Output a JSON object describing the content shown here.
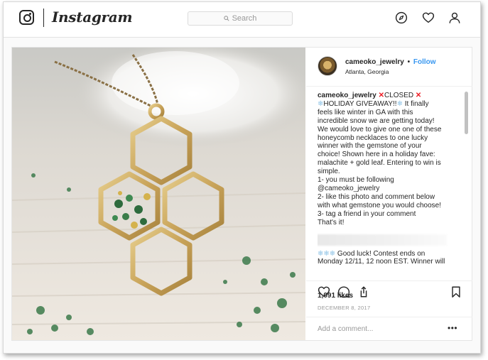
{
  "nav": {
    "brand": "Instagram",
    "search_placeholder": "Search",
    "icons": [
      "instagram-glyph-icon",
      "compass-icon",
      "heart-icon",
      "profile-icon"
    ]
  },
  "post": {
    "username": "cameoko_jewelry",
    "separator": "•",
    "follow_label": "Follow",
    "location": "Atlanta, Georgia",
    "caption_lines": [
      "It finally",
      "feels like winter in GA with this",
      "incredible snow we are getting today!",
      "We would love to give one one of these",
      "honeycomb necklaces to one lucky",
      "winner with the gemstone of your",
      "choice! Shown here in a holiday fave:",
      "malachite + gold leaf. Entering to win is",
      "simple.",
      "1- you must be following",
      "@cameoko_jewelry",
      "2- like this photo and comment below",
      "with what gemstone you would choose!",
      "3- tag a friend in your comment",
      "That's it!"
    ],
    "caption_head_closed": "CLOSED",
    "caption_head_giveaway": "HOLIDAY GIVEAWAY!!",
    "caption_tail": [
      "Good luck! Contest ends on",
      "Monday 12/11, 12 noon EST. Winner will"
    ],
    "likes": "1,091 likes",
    "date": "DECEMBER 8, 2017",
    "comment_placeholder": "Add a comment...",
    "more_label": "•••"
  },
  "colors": {
    "follow_blue": "#3897f0",
    "closed_red": "#ed1c24",
    "snowflake_blue": "#8ec3e6"
  }
}
